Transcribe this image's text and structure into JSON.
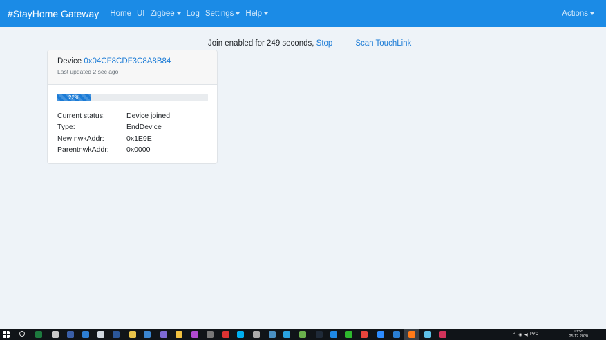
{
  "navbar": {
    "brand": "#StayHome Gateway",
    "items": [
      {
        "label": "Home",
        "dropdown": false
      },
      {
        "label": "UI",
        "dropdown": false
      },
      {
        "label": "Zigbee",
        "dropdown": true
      },
      {
        "label": "Log",
        "dropdown": false
      },
      {
        "label": "Settings",
        "dropdown": true
      },
      {
        "label": "Help",
        "dropdown": true
      }
    ],
    "actions_label": "Actions",
    "color": "#1b8be6"
  },
  "join": {
    "text": "Join enabled for 249 seconds,",
    "stop_label": "Stop",
    "scan_label": "Scan TouchLink"
  },
  "device": {
    "title_prefix": "Device",
    "id": "0x04CF8CDF3C8A8B84",
    "last_updated": "Last updated 2 sec ago",
    "progress_label": "22%",
    "progress_percent": 22,
    "rows": [
      {
        "label": "Current status:",
        "value": "Device joined"
      },
      {
        "label": "Type:",
        "value": "EndDevice"
      },
      {
        "label": "New nwkAddr:",
        "value": "0x1E9E"
      },
      {
        "label": "ParentnwkAddr:",
        "value": "0x0000"
      }
    ]
  },
  "taskbar": {
    "language": "РУС",
    "time": "13:55",
    "date": "25.12.2020",
    "apps": [
      "search-icon",
      "excel-icon",
      "app-icon",
      "lr-icon",
      "ps-icon",
      "doc-icon",
      "word-icon",
      "folder-icon",
      "browser-icon",
      "tool-icon",
      "notes-icon",
      "media-icon",
      "app-icon",
      "save-icon",
      "skype-icon",
      "app-icon",
      "app-icon",
      "telegram-icon",
      "notepad-icon",
      "terminal-icon",
      "edge-icon",
      "app-icon",
      "chrome-icon",
      "zoom-icon",
      "vscode-icon",
      "firefox-icon",
      "app-icon",
      "app-icon"
    ]
  }
}
